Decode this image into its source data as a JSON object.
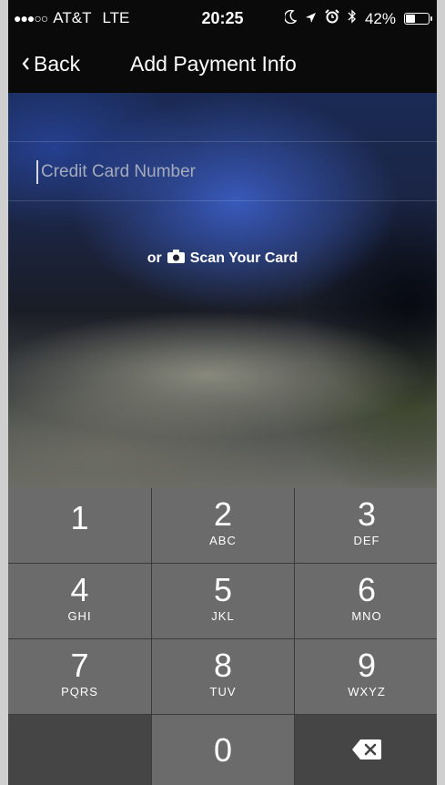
{
  "status_bar": {
    "signal": "●●●○○",
    "carrier": "AT&T",
    "network": "LTE",
    "time": "20:25",
    "battery_percent": "42%",
    "battery_level": 0.42
  },
  "nav": {
    "back_label": "Back",
    "title": "Add Payment Info"
  },
  "card_field": {
    "placeholder": "Credit Card Number",
    "value": ""
  },
  "scan": {
    "prefix": "or",
    "label": "Scan Your Card",
    "icon": "camera-icon"
  },
  "keypad": {
    "keys": [
      {
        "num": "1",
        "letters": ""
      },
      {
        "num": "2",
        "letters": "ABC"
      },
      {
        "num": "3",
        "letters": "DEF"
      },
      {
        "num": "4",
        "letters": "GHI"
      },
      {
        "num": "5",
        "letters": "JKL"
      },
      {
        "num": "6",
        "letters": "MNO"
      },
      {
        "num": "7",
        "letters": "PQRS"
      },
      {
        "num": "8",
        "letters": "TUV"
      },
      {
        "num": "9",
        "letters": "WXYZ"
      },
      {
        "num": "0",
        "letters": ""
      }
    ],
    "delete_icon": "backspace-icon"
  }
}
